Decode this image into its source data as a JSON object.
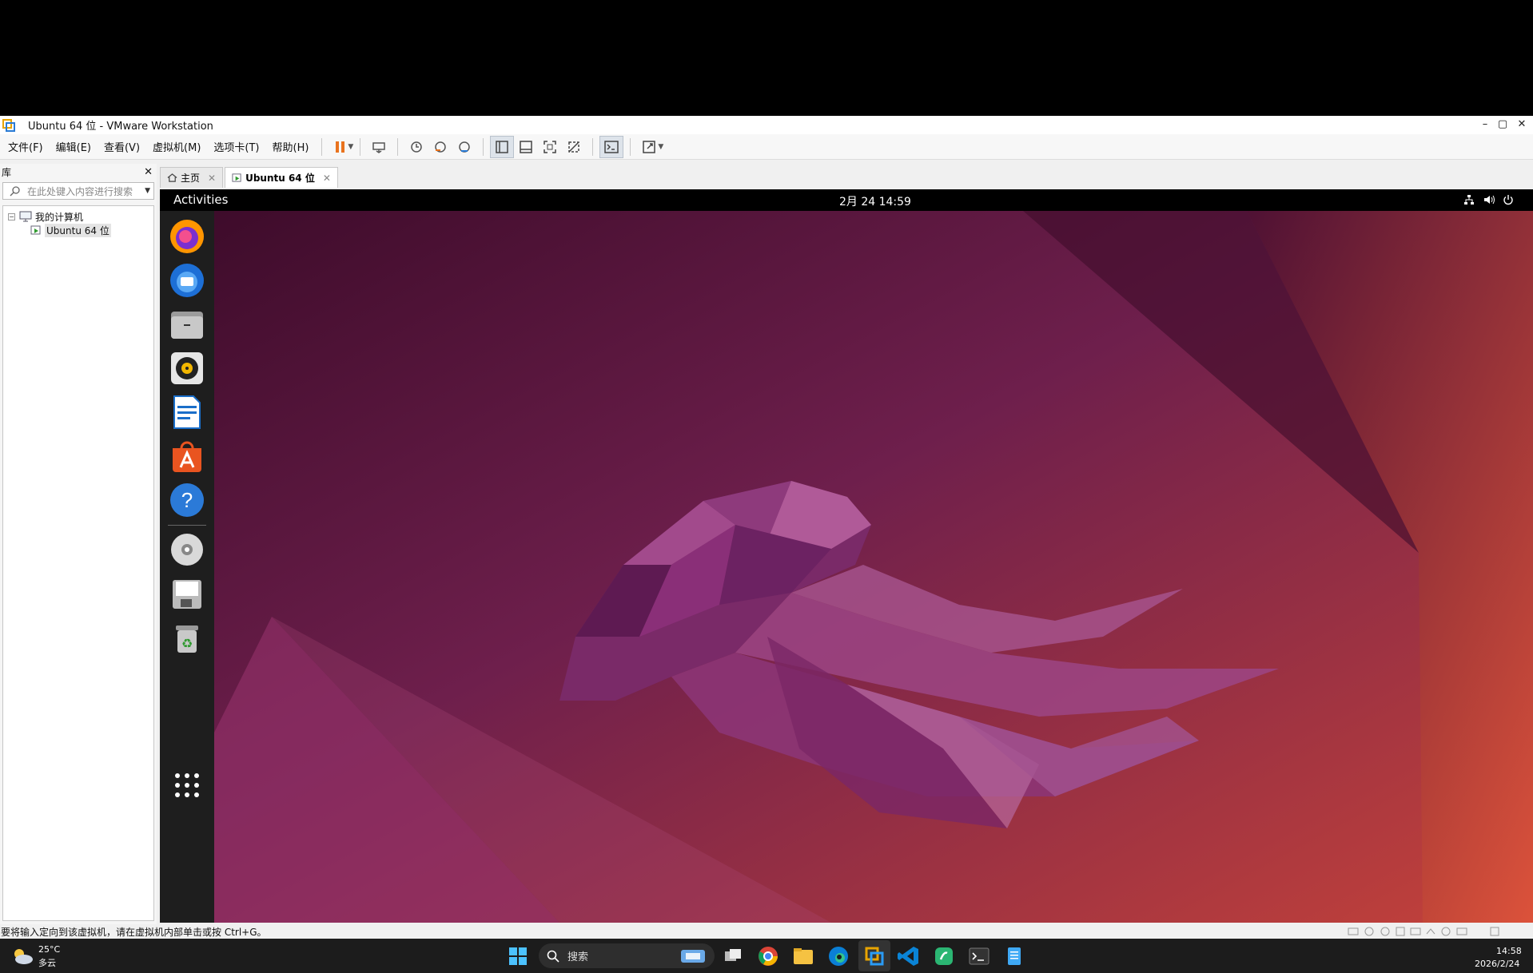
{
  "window": {
    "title": "Ubuntu 64 位 - VMware Workstation",
    "minimize": "–",
    "maximize": "▢",
    "close": "✕"
  },
  "menu": [
    "文件(F)",
    "编辑(E)",
    "查看(V)",
    "虚拟机(M)",
    "选项卡(T)",
    "帮助(H)"
  ],
  "library": {
    "title": "库",
    "close": "✕",
    "search_placeholder": "在此处键入内容进行搜索",
    "root": "我的计算机",
    "vm": "Ubuntu 64 位",
    "expander": "−"
  },
  "tabs": [
    {
      "label": "主页",
      "active": false
    },
    {
      "label": "Ubuntu 64 位",
      "active": true
    }
  ],
  "ubuntu": {
    "activities": "Activities",
    "clock": "2月 24  14:59",
    "dock": [
      "firefox",
      "thunderbird",
      "files",
      "rhythmbox",
      "libreoffice-writer",
      "app-center",
      "help",
      "dvd",
      "floppy",
      "trash",
      "show-apps"
    ]
  },
  "status_text": "要将输入定向到该虚拟机，请在虚拟机内部单击或按 Ctrl+G。",
  "taskbar": {
    "weather_temp": "25°C",
    "weather_desc": "多云",
    "search_label": "搜索",
    "time": "14:58",
    "date": "2026/2/24"
  },
  "colors": {
    "ubuntu_bg": "#6b1f4a",
    "ubuntu_accent": "#e95420",
    "dock_bg": "#1e1e1e",
    "taskbar_bg": "#1c1c1c"
  }
}
